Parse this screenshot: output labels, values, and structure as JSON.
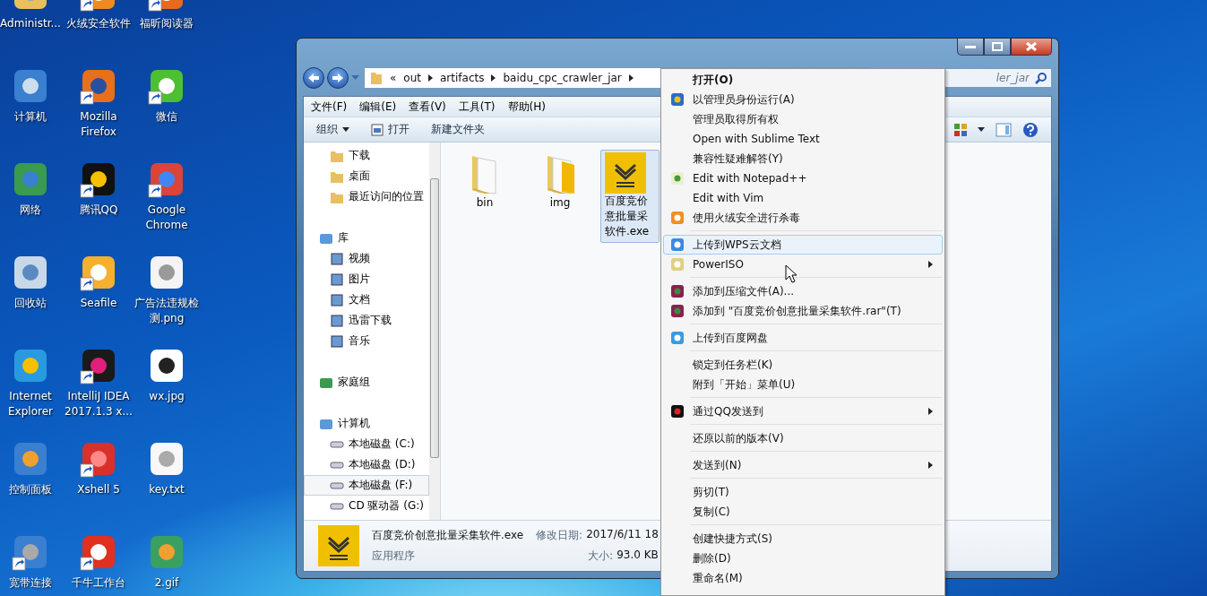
{
  "desktop_icons": [
    {
      "label": "Administr...",
      "shortcut": false
    },
    {
      "label": "火绒安全软件",
      "shortcut": true
    },
    {
      "label": "福昕阅读器",
      "shortcut": true
    },
    {
      "label": "计算机",
      "shortcut": false
    },
    {
      "label": "Mozilla Firefox",
      "shortcut": true
    },
    {
      "label": "微信",
      "shortcut": true
    },
    {
      "label": "网络",
      "shortcut": false
    },
    {
      "label": "腾讯QQ",
      "shortcut": true
    },
    {
      "label": "Google Chrome",
      "shortcut": true
    },
    {
      "label": "回收站",
      "shortcut": false
    },
    {
      "label": "Seafile",
      "shortcut": true
    },
    {
      "label": "广告法违规检测.png",
      "shortcut": false
    },
    {
      "label": "Internet Explorer",
      "shortcut": false
    },
    {
      "label": "IntelliJ IDEA 2017.1.3 x...",
      "shortcut": true
    },
    {
      "label": "wx.jpg",
      "shortcut": false
    },
    {
      "label": "控制面板",
      "shortcut": false
    },
    {
      "label": "Xshell 5",
      "shortcut": true
    },
    {
      "label": "key.txt",
      "shortcut": false
    },
    {
      "label": "宽带连接",
      "shortcut": true
    },
    {
      "label": "千牛工作台",
      "shortcut": true
    },
    {
      "label": "2.gif",
      "shortcut": false
    }
  ],
  "explorer": {
    "address": {
      "prefix": "«",
      "crumbs": [
        "out",
        "artifacts",
        "baidu_cpc_crawler_jar"
      ]
    },
    "search": {
      "placeholder": "ler_jar"
    },
    "menu_bar": [
      "文件(F)",
      "编辑(E)",
      "查看(V)",
      "工具(T)",
      "帮助(H)"
    ],
    "toolbar": [
      {
        "label": "组织",
        "kind": "dropdown"
      },
      {
        "label": "打开",
        "kind": "open"
      },
      {
        "label": "新建文件夹",
        "kind": "plain"
      }
    ],
    "nav_pane": {
      "favorites": [
        {
          "label": "下载",
          "selected": false
        },
        {
          "label": "桌面",
          "selected": false
        },
        {
          "label": "最近访问的位置",
          "selected": false
        }
      ],
      "sections": [
        {
          "label": "库",
          "children": [
            {
              "label": "视频",
              "selected": false
            },
            {
              "label": "图片",
              "selected": false
            },
            {
              "label": "文档",
              "selected": false
            },
            {
              "label": "迅雷下载",
              "selected": false
            },
            {
              "label": "音乐",
              "selected": false
            }
          ]
        },
        {
          "label": "家庭组"
        },
        {
          "label": "计算机",
          "children": [
            {
              "label": "本地磁盘 (C:)",
              "selected": false
            },
            {
              "label": "本地磁盘 (D:)",
              "selected": false
            },
            {
              "label": "本地磁盘 (F:)",
              "selected": true
            },
            {
              "label": "CD 驱动器 (G:)",
              "selected": false
            }
          ]
        }
      ]
    },
    "files": [
      {
        "kind": "folder",
        "lines": [
          "bin"
        ],
        "selected": false
      },
      {
        "kind": "folder-open",
        "lines": [
          "img"
        ],
        "selected": false
      },
      {
        "kind": "exe",
        "lines": [
          "百度竞价",
          "意批量采",
          "软件.exe"
        ],
        "selected": true
      }
    ],
    "details": {
      "name": "百度竞价创意批量采集软件.exe",
      "type": "应用程序",
      "modified_label": "修改日期:",
      "modified": "2017/6/11 18",
      "size_label": "大小:",
      "size": "93.0 KB"
    }
  },
  "context_menu": {
    "items": [
      {
        "kind": "item",
        "label": "打开(O)",
        "default": true,
        "selected": false,
        "submenu": false
      },
      {
        "kind": "item",
        "label": "以管理员身份运行(A)",
        "default": false,
        "selected": false,
        "submenu": false
      },
      {
        "kind": "item",
        "label": "管理员取得所有权",
        "default": false,
        "selected": false,
        "submenu": false
      },
      {
        "kind": "item",
        "label": "Open with Sublime Text",
        "default": false,
        "selected": false,
        "submenu": false
      },
      {
        "kind": "item",
        "label": "兼容性疑难解答(Y)",
        "default": false,
        "selected": false,
        "submenu": false
      },
      {
        "kind": "item",
        "label": "Edit with Notepad++",
        "default": false,
        "selected": false,
        "submenu": false
      },
      {
        "kind": "item",
        "label": "Edit with Vim",
        "default": false,
        "selected": false,
        "submenu": false
      },
      {
        "kind": "item",
        "label": "使用火绒安全进行杀毒",
        "default": false,
        "selected": false,
        "submenu": false
      },
      {
        "kind": "separator"
      },
      {
        "kind": "item",
        "label": "上传到WPS云文档",
        "default": false,
        "selected": true,
        "submenu": false
      },
      {
        "kind": "item",
        "label": "PowerISO",
        "default": false,
        "selected": false,
        "submenu": true
      },
      {
        "kind": "separator"
      },
      {
        "kind": "item",
        "label": "添加到压缩文件(A)...",
        "default": false,
        "selected": false,
        "submenu": false
      },
      {
        "kind": "item",
        "label": "添加到 \"百度竞价创意批量采集软件.rar\"(T)",
        "default": false,
        "selected": false,
        "submenu": false
      },
      {
        "kind": "separator"
      },
      {
        "kind": "item",
        "label": "上传到百度网盘",
        "default": false,
        "selected": false,
        "submenu": false
      },
      {
        "kind": "separator"
      },
      {
        "kind": "item",
        "label": "锁定到任务栏(K)",
        "default": false,
        "selected": false,
        "submenu": false
      },
      {
        "kind": "item",
        "label": "附到「开始」菜单(U)",
        "default": false,
        "selected": false,
        "submenu": false
      },
      {
        "kind": "separator"
      },
      {
        "kind": "item",
        "label": "通过QQ发送到",
        "default": false,
        "selected": false,
        "submenu": true
      },
      {
        "kind": "separator"
      },
      {
        "kind": "item",
        "label": "还原以前的版本(V)",
        "default": false,
        "selected": false,
        "submenu": false
      },
      {
        "kind": "separator"
      },
      {
        "kind": "item",
        "label": "发送到(N)",
        "default": false,
        "selected": false,
        "submenu": true
      },
      {
        "kind": "separator"
      },
      {
        "kind": "item",
        "label": "剪切(T)",
        "default": false,
        "selected": false,
        "submenu": false
      },
      {
        "kind": "item",
        "label": "复制(C)",
        "default": false,
        "selected": false,
        "submenu": false
      },
      {
        "kind": "separator"
      },
      {
        "kind": "item",
        "label": "创建快捷方式(S)",
        "default": false,
        "selected": false,
        "submenu": false
      },
      {
        "kind": "item",
        "label": "删除(D)",
        "default": false,
        "selected": false,
        "submenu": false
      },
      {
        "kind": "item",
        "label": "重命名(M)",
        "default": false,
        "selected": false,
        "submenu": false
      }
    ]
  }
}
